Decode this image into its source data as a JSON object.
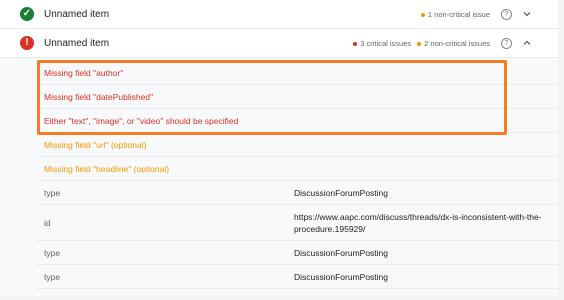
{
  "items": [
    {
      "title": "Unnamed item",
      "status": "ok",
      "issues": {
        "noncritical": "1 non-critical issue"
      },
      "expanded": false
    },
    {
      "title": "Unnamed item",
      "status": "error",
      "issues": {
        "critical": "3 critical issues",
        "noncritical": "2 non-critical issues"
      },
      "expanded": true,
      "errors": [
        "Missing field \"author\"",
        "Missing field \"datePublished\"",
        "Either \"text\", \"image\", or \"video\" should be specified"
      ],
      "warnings": [
        "Missing field \"url\" (optional)",
        "Missing field \"headline\" (optional)"
      ],
      "properties": [
        {
          "key": "type",
          "value": "DiscussionForumPosting"
        },
        {
          "key": "id",
          "value": "https://www.aapc.com/discuss/threads/dx-is-inconsistent-with-the-procedure.195929/"
        },
        {
          "key": "type",
          "value": "DiscussionForumPosting"
        },
        {
          "key": "type",
          "value": "DiscussionForumPosting"
        }
      ]
    }
  ],
  "icons": {
    "ok": "check-circle-icon",
    "error": "error-circle-icon",
    "help": "help-circle-icon",
    "chevron_down": "chevron-down-icon",
    "chevron_up": "chevron-up-icon"
  },
  "colors": {
    "ok": "#188038",
    "error": "#d93025",
    "warning": "#f29900",
    "highlight": "#f57c24"
  }
}
